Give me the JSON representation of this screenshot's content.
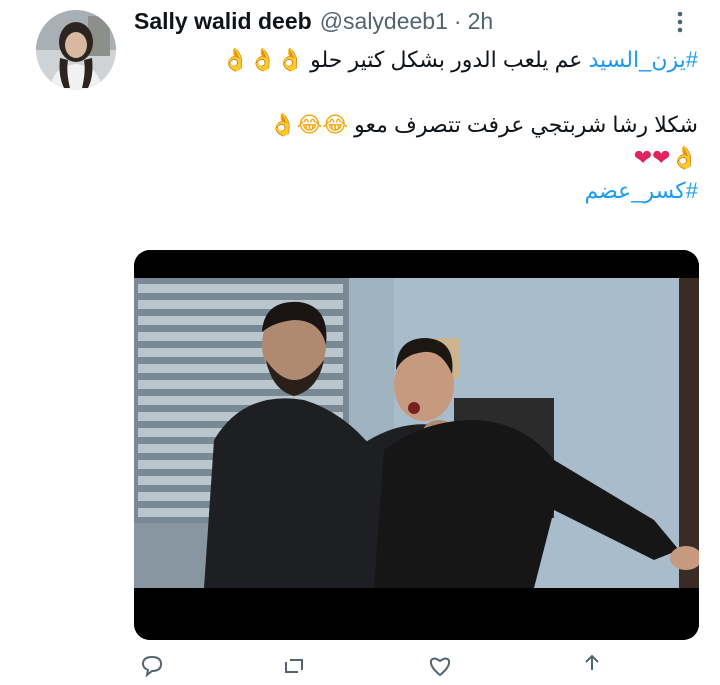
{
  "tweet": {
    "author": {
      "display_name": "Sally walid deeb",
      "handle": "@salydeeb1",
      "avatar_icon": "profile-photo"
    },
    "separator": "·",
    "time": "2h",
    "text_lines": [
      {
        "hashtag": "#يزن_السيد",
        "text": " عم يلعب الدور بشكل كتير حلو ",
        "emoji": "👌👌👌"
      },
      {
        "text": "شكلا رشا شربتجي عرفت تتصرف معو ",
        "emoji_laugh": "😂😂",
        "emoji_ok": "👌"
      },
      {
        "emoji_ok": "👌",
        "emoji_hearts": "❤❤"
      },
      {
        "hashtag": "#كسر_عضم"
      }
    ],
    "media": {
      "type": "video-still",
      "letterbox_color": "#000000"
    },
    "action_icons": [
      "reply-icon",
      "retweet-icon",
      "like-icon",
      "share-icon"
    ]
  }
}
